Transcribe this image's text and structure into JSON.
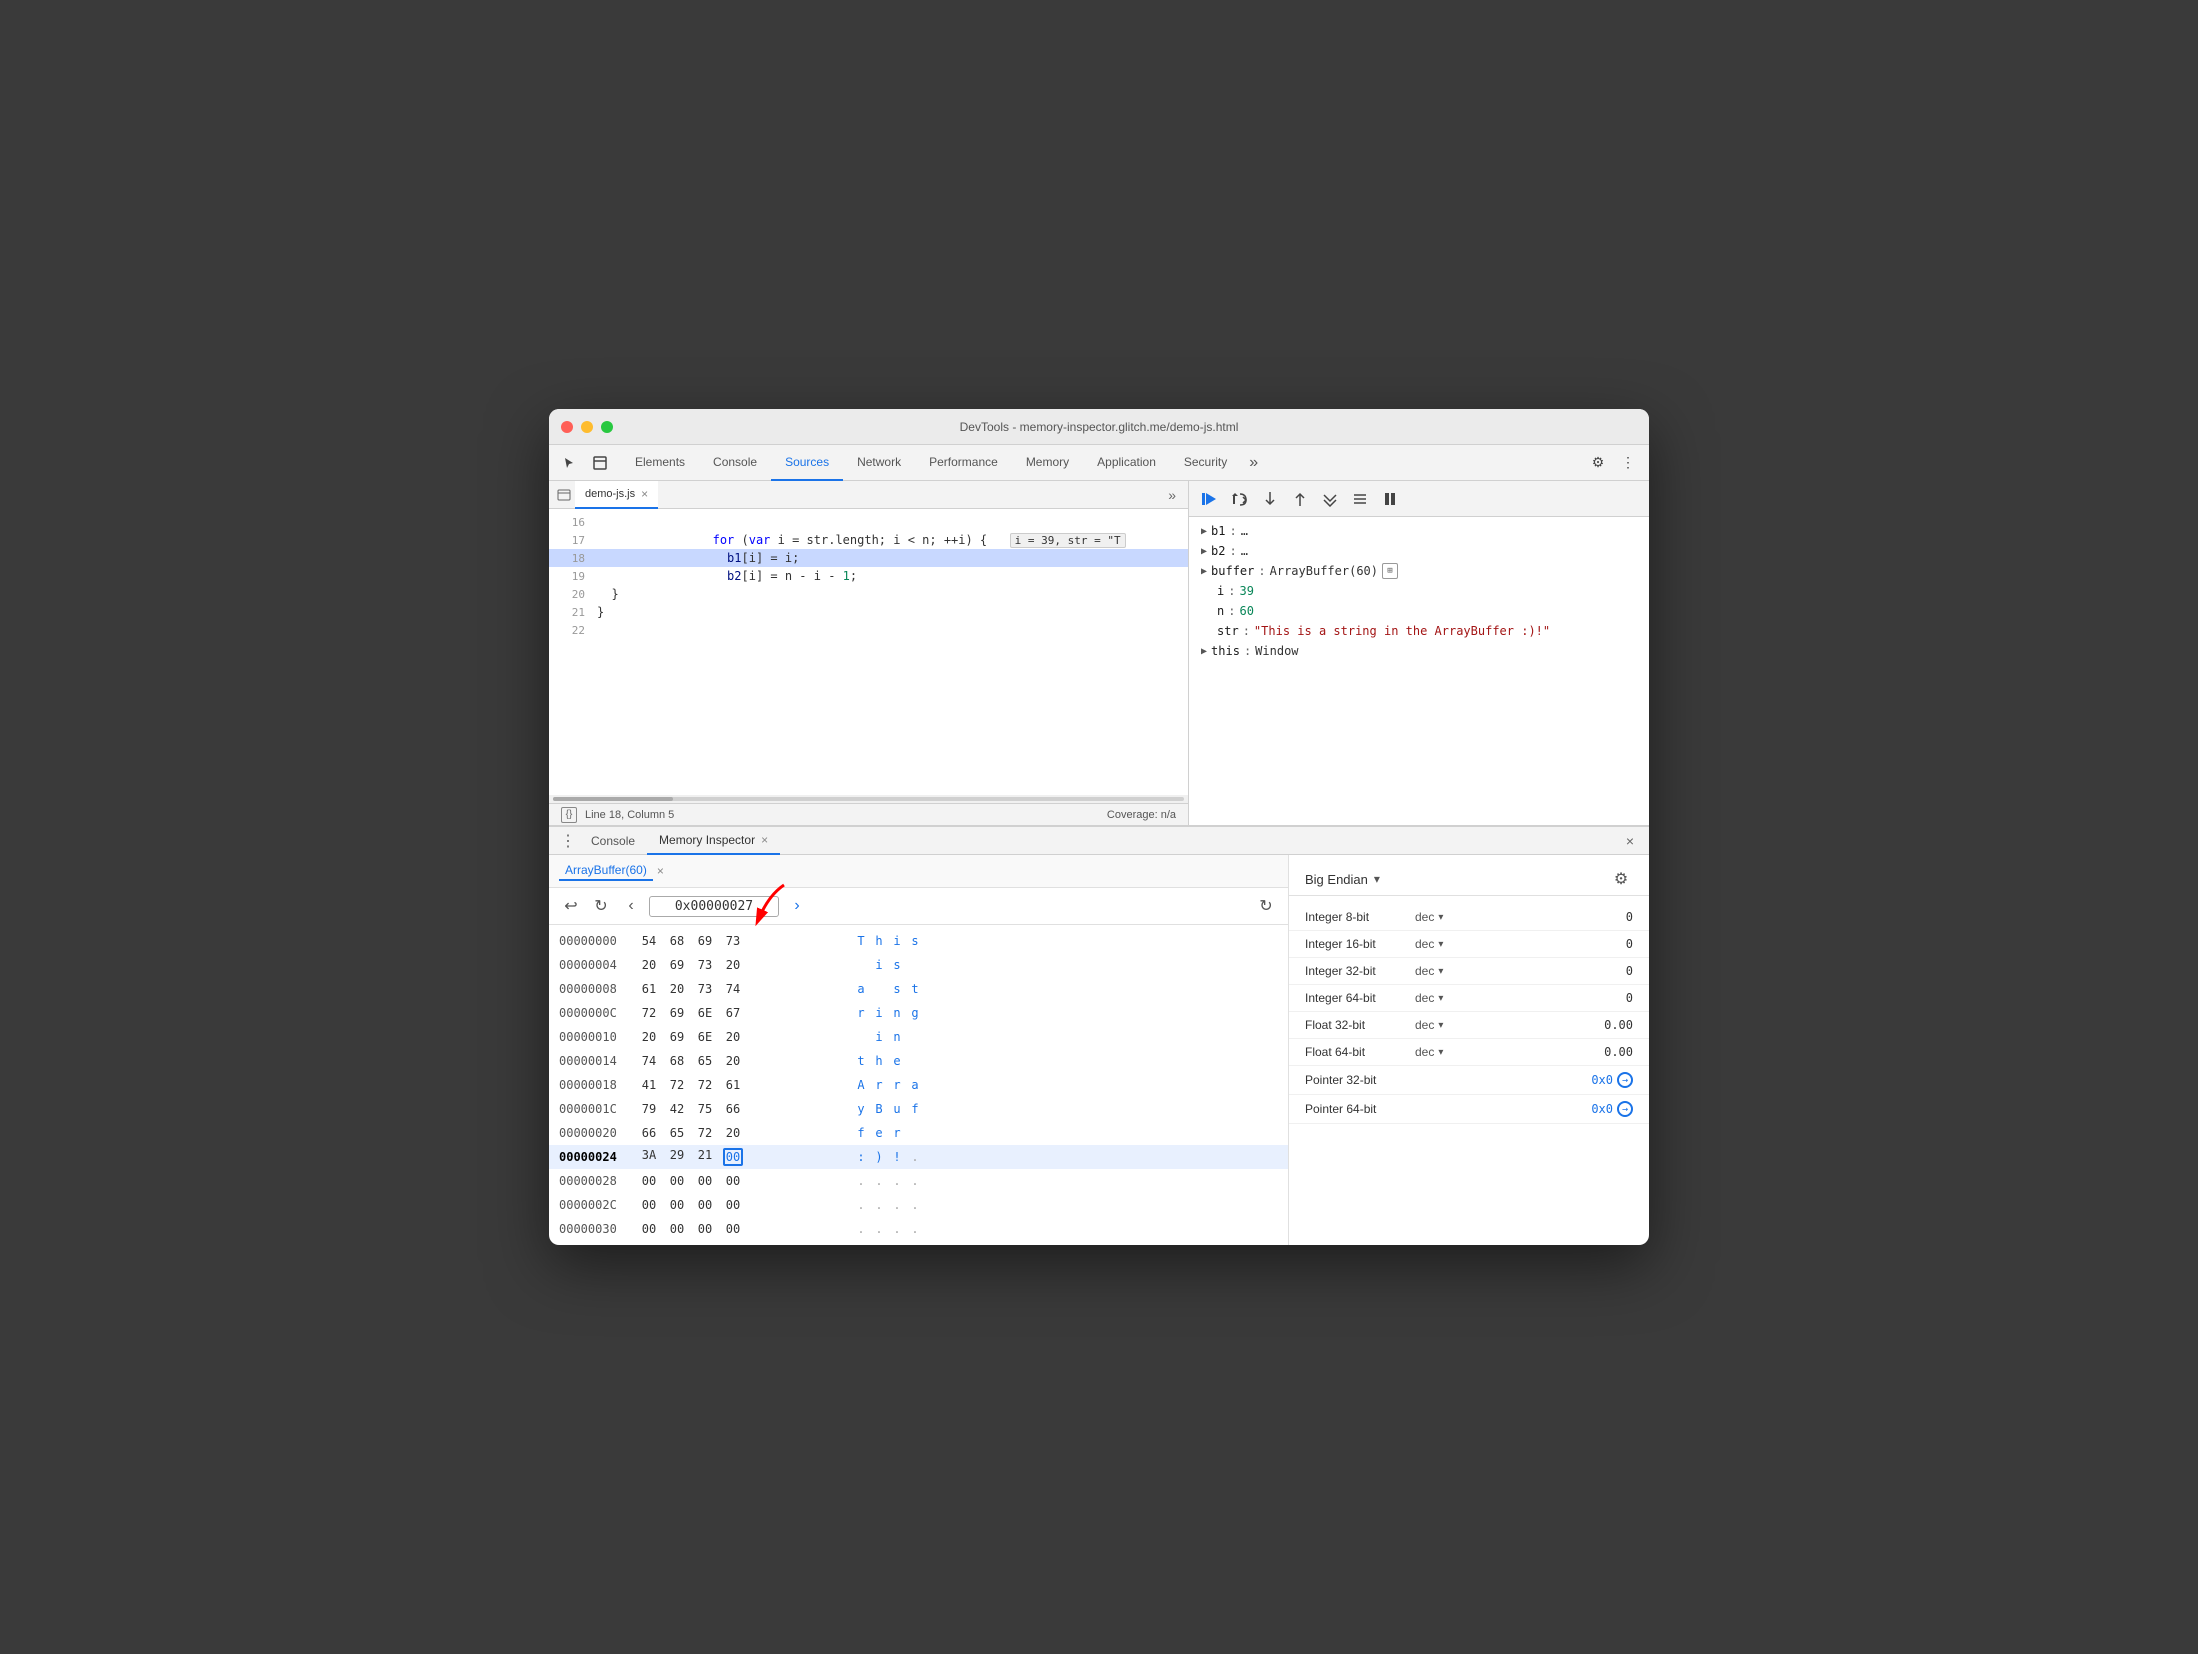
{
  "window": {
    "title": "DevTools - memory-inspector.glitch.me/demo-js.html"
  },
  "nav_tabs": {
    "items": [
      {
        "label": "Elements",
        "active": false
      },
      {
        "label": "Console",
        "active": false
      },
      {
        "label": "Sources",
        "active": true
      },
      {
        "label": "Network",
        "active": false
      },
      {
        "label": "Performance",
        "active": false
      },
      {
        "label": "Memory",
        "active": false
      },
      {
        "label": "Application",
        "active": false
      },
      {
        "label": "Security",
        "active": false
      }
    ],
    "overflow_label": "»"
  },
  "file_tab": {
    "name": "demo-js.js",
    "close_label": "×"
  },
  "code": {
    "lines": [
      {
        "num": "16",
        "content": ""
      },
      {
        "num": "17",
        "content": "   for (var i = str.length; i < n; ++i) {",
        "tooltip": "i = 39, str = \"T"
      },
      {
        "num": "18",
        "content": "      b1[i] = i;",
        "highlighted": true
      },
      {
        "num": "19",
        "content": "      b2[i] = n - i - 1;"
      },
      {
        "num": "20",
        "content": "   }"
      },
      {
        "num": "21",
        "content": "}"
      },
      {
        "num": "22",
        "content": ""
      }
    ]
  },
  "status_bar": {
    "left": "Line 18, Column 5",
    "right": "Coverage: n/a",
    "icon_label": "{}"
  },
  "debugger": {
    "vars": [
      {
        "name": "b1",
        "sep": ":",
        "val": "…",
        "type": "normal"
      },
      {
        "name": "b2",
        "sep": ":",
        "val": "…",
        "type": "normal"
      },
      {
        "name": "buffer",
        "sep": ":",
        "val": "ArrayBuffer(60)",
        "type": "normal",
        "has_icon": true
      },
      {
        "name": "i",
        "sep": ":",
        "val": "39",
        "type": "num"
      },
      {
        "name": "n",
        "sep": ":",
        "val": "60",
        "type": "num"
      },
      {
        "name": "str",
        "sep": ":",
        "val": "\"This is a string in the ArrayBuffer :)!\"",
        "type": "str"
      },
      {
        "name": "this",
        "sep": ":",
        "val": "Window",
        "type": "normal"
      }
    ]
  },
  "bottom_tabs": {
    "console_label": "Console",
    "memory_label": "Memory Inspector",
    "close_label": "×",
    "panel_close": "×"
  },
  "memory_inspector": {
    "tab_label": "ArrayBuffer(60)",
    "tab_close": "×",
    "address_value": "0x00000027",
    "endian_label": "Big Endian",
    "nav_prev": "‹",
    "nav_next": "›",
    "rows": [
      {
        "addr": "00000000",
        "bytes": [
          "54",
          "68",
          "69",
          "73"
        ],
        "chars": [
          "T",
          "h",
          "i",
          "s"
        ],
        "highlighted": false
      },
      {
        "addr": "00000004",
        "bytes": [
          "20",
          "69",
          "73",
          "20"
        ],
        "chars": [
          " ",
          "i",
          "s",
          " "
        ],
        "highlighted": false
      },
      {
        "addr": "00000008",
        "bytes": [
          "61",
          "20",
          "73",
          "74"
        ],
        "chars": [
          "a",
          " ",
          "s",
          "t"
        ],
        "highlighted": false
      },
      {
        "addr": "0000000C",
        "bytes": [
          "72",
          "69",
          "6E",
          "67"
        ],
        "chars": [
          "r",
          "i",
          "n",
          "g"
        ],
        "highlighted": false
      },
      {
        "addr": "00000010",
        "bytes": [
          "20",
          "69",
          "6E",
          "20"
        ],
        "chars": [
          " ",
          "i",
          "n",
          " "
        ],
        "highlighted": false
      },
      {
        "addr": "00000014",
        "bytes": [
          "74",
          "68",
          "65",
          "20"
        ],
        "chars": [
          "t",
          "h",
          "e",
          " "
        ],
        "highlighted": false
      },
      {
        "addr": "00000018",
        "bytes": [
          "41",
          "72",
          "72",
          "61"
        ],
        "chars": [
          "A",
          "r",
          "r",
          "a"
        ],
        "highlighted": false
      },
      {
        "addr": "0000001C",
        "bytes": [
          "79",
          "42",
          "75",
          "66"
        ],
        "chars": [
          "y",
          "B",
          "u",
          "f"
        ],
        "highlighted": false
      },
      {
        "addr": "00000020",
        "bytes": [
          "66",
          "65",
          "72",
          "20"
        ],
        "chars": [
          "f",
          "e",
          "r",
          " "
        ],
        "highlighted": false
      },
      {
        "addr": "00000024",
        "bytes": [
          "3A",
          "29",
          "21",
          "00"
        ],
        "chars": [
          ":",
          ")",
          "!",
          "."
        ],
        "highlighted": true,
        "selected_byte_idx": 3
      },
      {
        "addr": "00000028",
        "bytes": [
          "00",
          "00",
          "00",
          "00"
        ],
        "chars": [
          ".",
          ".",
          ".",
          "."
        ],
        "highlighted": false
      },
      {
        "addr": "0000002C",
        "bytes": [
          "00",
          "00",
          "00",
          "00"
        ],
        "chars": [
          ".",
          ".",
          ".",
          "."
        ],
        "highlighted": false
      },
      {
        "addr": "00000030",
        "bytes": [
          "00",
          "00",
          "00",
          "00"
        ],
        "chars": [
          ".",
          ".",
          ".",
          "."
        ],
        "highlighted": false
      }
    ],
    "types": [
      {
        "name": "Integer 8-bit",
        "format": "dec",
        "value": "0"
      },
      {
        "name": "Integer 16-bit",
        "format": "dec",
        "value": "0"
      },
      {
        "name": "Integer 32-bit",
        "format": "dec",
        "value": "0"
      },
      {
        "name": "Integer 64-bit",
        "format": "dec",
        "value": "0"
      },
      {
        "name": "Float 32-bit",
        "format": "dec",
        "value": "0.00"
      },
      {
        "name": "Float 64-bit",
        "format": "dec",
        "value": "0.00"
      }
    ],
    "pointers": [
      {
        "name": "Pointer 32-bit",
        "value": "0x0"
      },
      {
        "name": "Pointer 64-bit",
        "value": "0x0"
      }
    ]
  }
}
